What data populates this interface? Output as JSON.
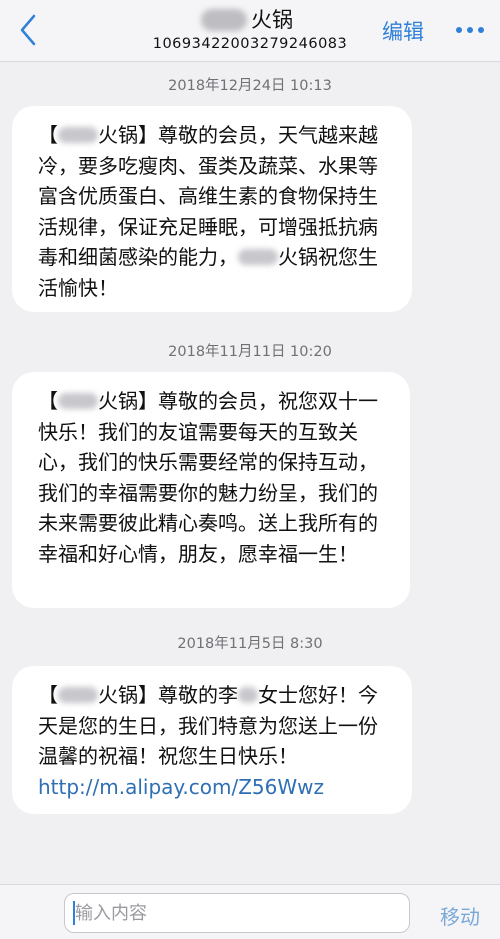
{
  "header": {
    "title": "火锅",
    "number": "1069342200327924​6083",
    "edit_label": "编辑"
  },
  "messages": [
    {
      "timestamp": "2018年12月24日 10:13",
      "segments": [
        {
          "text": "【",
          "blur": false
        },
        {
          "text": "某某",
          "blur": true
        },
        {
          "text": "火锅】尊敬的会员，天气越来越冷，要多吃瘦肉、蛋类及蔬菜、水果等富含优质蛋白、高维生素的食物保持生活规律，保证充足睡眠，可增强抵抗病毒和细菌感染的能力，",
          "blur": false
        },
        {
          "text": "某某",
          "blur": true
        },
        {
          "text": "火锅祝您生活愉快！",
          "blur": false
        }
      ]
    },
    {
      "timestamp": "2018年11月11日 10:20",
      "segments": [
        {
          "text": "【",
          "blur": false
        },
        {
          "text": "某某",
          "blur": true
        },
        {
          "text": "火锅】尊敬的会员，祝您双十一快乐！我们的友谊需要每天的互致关心，我们的快乐需要经常的保持互动，我们的幸福需要你的魅力纷呈，我们的未来需要彼此精心奏鸣。送上我所有的幸福和好心情，朋友，愿幸福一生！",
          "blur": false
        }
      ]
    },
    {
      "timestamp": "2018年11月5日 8:30",
      "segments": [
        {
          "text": "【",
          "blur": false
        },
        {
          "text": "某某",
          "blur": true
        },
        {
          "text": "火锅】尊敬的李",
          "blur": false
        },
        {
          "text": "某",
          "blur": true
        },
        {
          "text": "女士您好！今天是您的生日，我们特意为您送上一份温馨的祝福！祝您生日快乐！",
          "blur": false
        }
      ],
      "link": "http://m.alipay.com/Z56Wwz"
    }
  ],
  "composer": {
    "placeholder": "输入内容",
    "send_label": "移动"
  },
  "colors": {
    "accent": "#2f80d9",
    "background": "#f0f0f3",
    "bubble": "#ffffff"
  }
}
